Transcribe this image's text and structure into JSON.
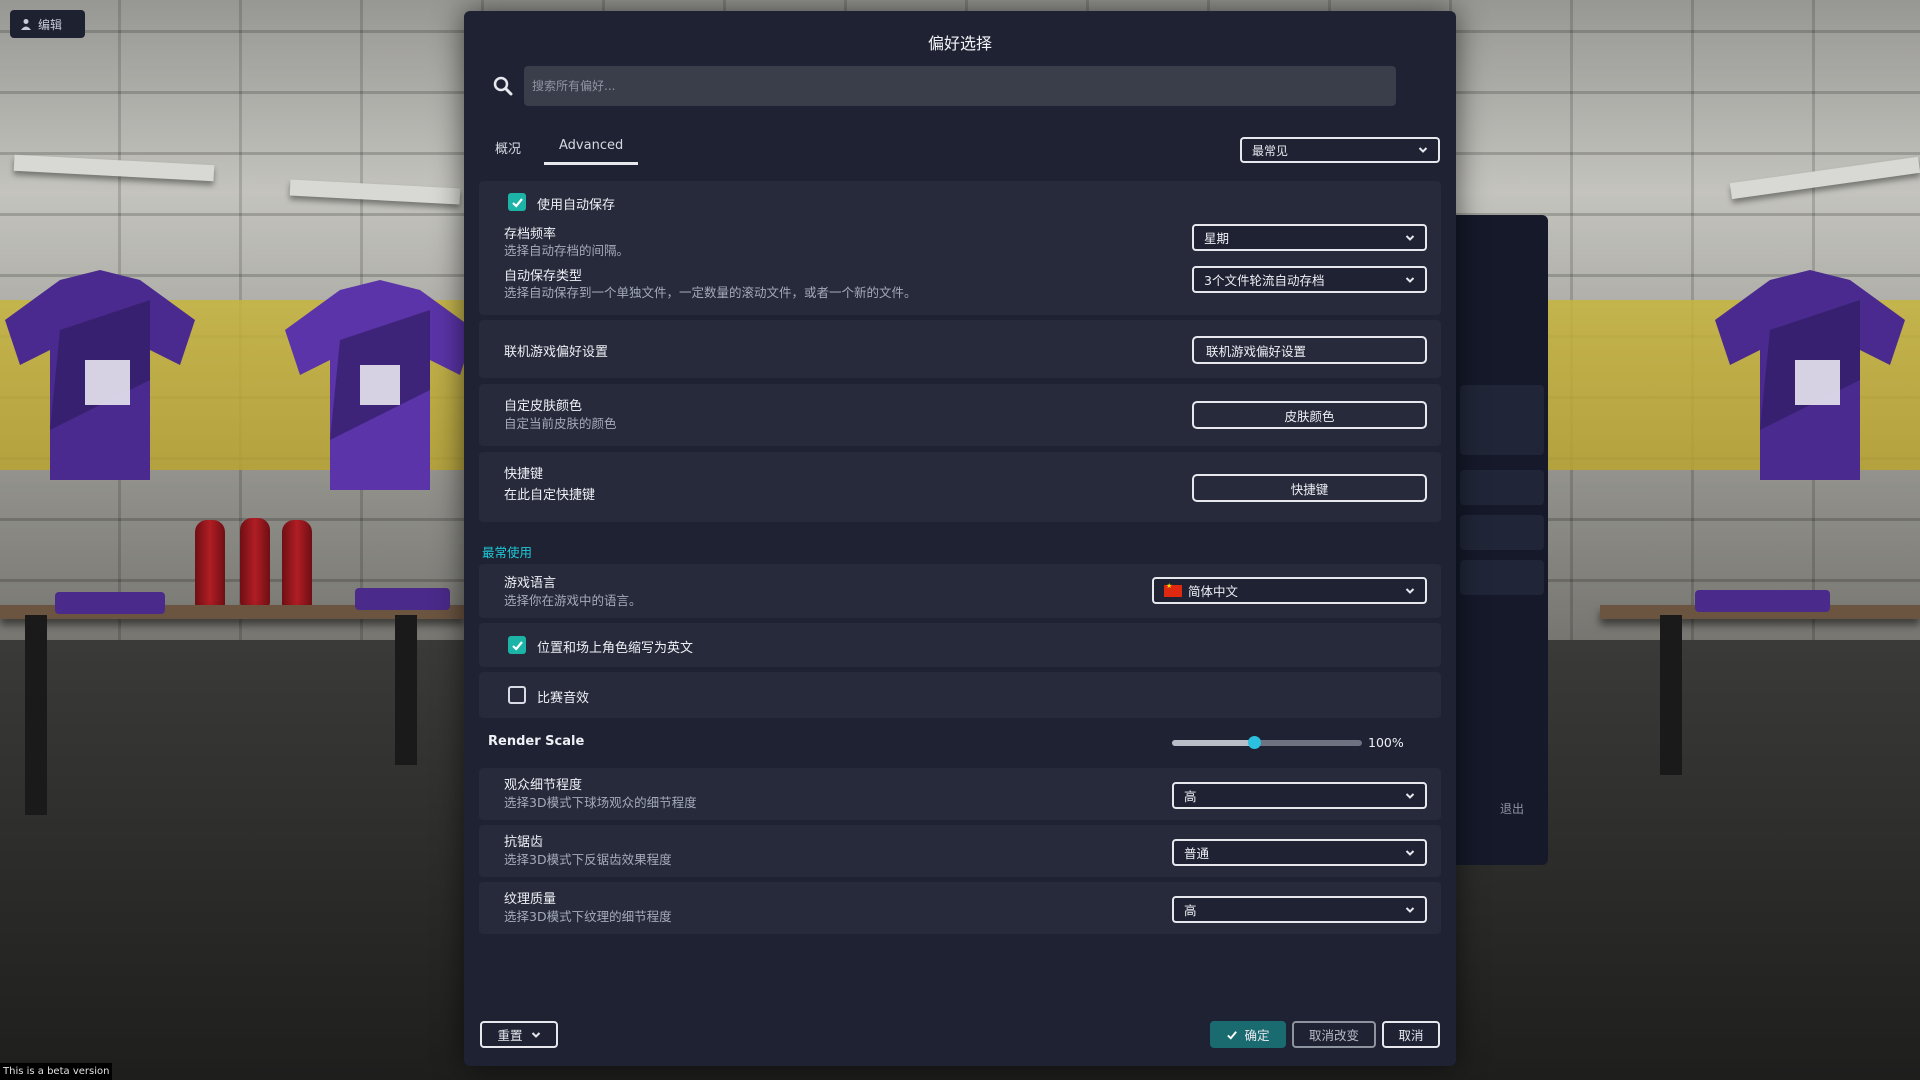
{
  "background": {
    "edit_label": "编辑",
    "beta_notice": "This is a beta version",
    "exit_label": "退出"
  },
  "dialog": {
    "title": "偏好选择",
    "search": {
      "placeholder": "搜索所有偏好..."
    },
    "tabs": [
      {
        "label": "概况",
        "active": false
      },
      {
        "label": "Advanced",
        "active": true
      }
    ],
    "sort_select": {
      "value": "最常见"
    },
    "autosave": {
      "enable_label": "使用自动保存",
      "enable_checked": true,
      "frequency": {
        "label": "存档频率",
        "desc": "选择自动存档的间隔。",
        "value": "星期"
      },
      "type": {
        "label": "自动保存类型",
        "desc": "选择自动保存到一个单独文件，一定数量的滚动文件，或者一个新的文件。",
        "value": "3个文件轮流自动存档"
      }
    },
    "online": {
      "label": "联机游戏偏好设置",
      "button": "联机游戏偏好设置"
    },
    "skin": {
      "label": "自定皮肤颜色",
      "desc": "自定当前皮肤的颜色",
      "button": "皮肤颜色"
    },
    "shortcuts": {
      "label": "快捷键",
      "desc": "在此自定快捷键",
      "button": "快捷键"
    },
    "section_title": "最常使用",
    "language": {
      "label": "游戏语言",
      "desc": "选择你在游戏中的语言。",
      "value": "简体中文"
    },
    "abbrev": {
      "label": "位置和场上角色缩写为英文",
      "checked": true
    },
    "match_sound": {
      "label": "比赛音效",
      "checked": false
    },
    "render_scale": {
      "label": "Render Scale",
      "value_text": "100%",
      "fraction": 0.43
    },
    "crowd": {
      "label": "观众细节程度",
      "desc": "选择3D模式下球场观众的细节程度",
      "value": "高"
    },
    "aa": {
      "label": "抗锯齿",
      "desc": "选择3D模式下反锯齿效果程度",
      "value": "普通"
    },
    "texture": {
      "label": "纹理质量",
      "desc": "选择3D模式下纹理的细节程度",
      "value": "高"
    },
    "footer": {
      "reset": "重置",
      "confirm": "确定",
      "discard": "取消改变",
      "cancel": "取消"
    }
  },
  "colors": {
    "accent": "#1bb4a6",
    "section": "#1ec8d8",
    "panel": "#1e2233",
    "card": "#262a3b"
  }
}
